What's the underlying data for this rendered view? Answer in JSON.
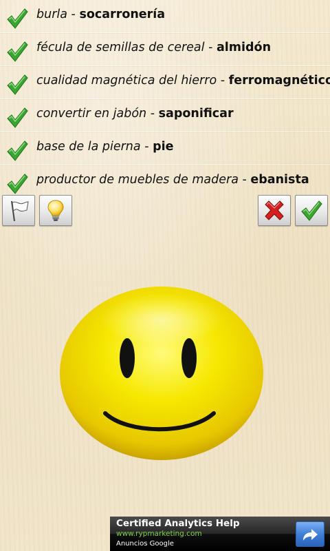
{
  "rows": [
    {
      "clue": "burla",
      "separator": " - ",
      "answer": "socarronería"
    },
    {
      "clue": "fécula de semillas de cereal",
      "separator": " - ",
      "answer": "almidón"
    },
    {
      "clue": "cualidad magnética del hierro",
      "separator": " - ",
      "answer": "ferromagnético"
    },
    {
      "clue": "convertir en jabón",
      "separator": " - ",
      "answer": "saponificar"
    },
    {
      "clue": "base de la pierna",
      "separator": " - ",
      "answer": "pie"
    },
    {
      "clue": "productor de muebles de madera",
      "separator": " - ",
      "answer": "ebanista"
    }
  ],
  "toolbar": {
    "flag_icon": "white-flag-icon",
    "hint_icon": "lightbulb-icon",
    "wrong_icon": "red-x-icon",
    "right_icon": "green-check-icon"
  },
  "ad": {
    "title": "Certified Analytics Help",
    "url": "www.rypmarketing.com",
    "attribution": "Anuncios Google"
  },
  "colors": {
    "check_green": "#3aa532",
    "wrong_red": "#d42020",
    "smiley_yellow": "#f5e000",
    "ad_url_green": "#7fcf4a"
  }
}
